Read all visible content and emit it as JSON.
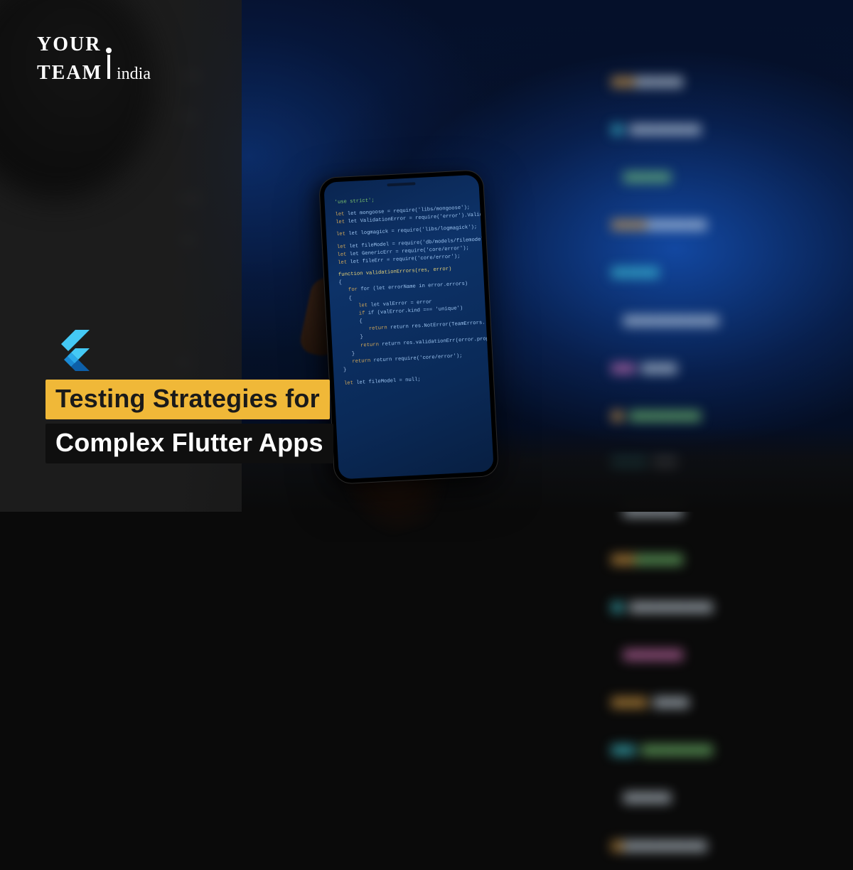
{
  "logo": {
    "line1": "Your",
    "line2": "Team",
    "line3_script": "india"
  },
  "title": {
    "line1": "Testing Strategies for",
    "line2": "Complex Flutter Apps"
  },
  "phone_code": {
    "l1": "'use strict';",
    "l2": "let mongoose = require('libs/mongoose');",
    "l3": "let ValidationError = require('error').ValidationErr",
    "l4": "let logmagick = require('libs/logmagick');",
    "l5": "let fileModel = require('db/models/filemodel');",
    "l6": "let GenericErr = require('core/error');",
    "l7": "let fileErr = require('core/error');",
    "l8": "function validationErrors(res, error)",
    "l9": "for (let errorName in error.errors)",
    "l10": "let valError = error",
    "l11": "if (valError.kind === 'unique')",
    "l12": "return res.NotError(TeamErrors.",
    "l13": "return res.validationErr(error.properties.",
    "l14": "return require('core/error');",
    "l15": "let fileModel = null;"
  },
  "bg_code_tokens": {
    "colors": {
      "cyan": "#44d4e0",
      "orange": "#e8a84a",
      "white": "#d8e4f0",
      "green": "#7fd67a",
      "pink": "#e078c0"
    }
  },
  "icons": {
    "flutter": "flutter-icon"
  }
}
